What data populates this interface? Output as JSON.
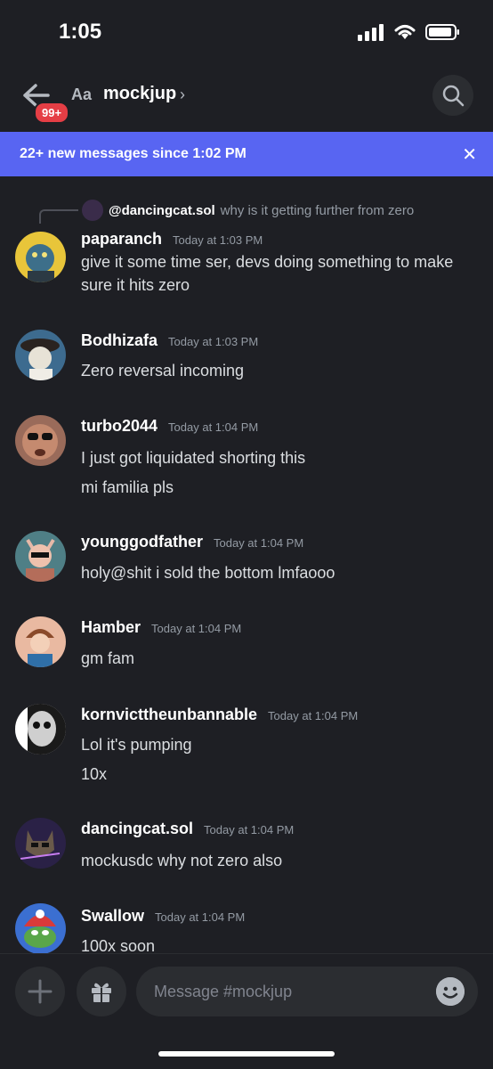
{
  "status": {
    "time": "1:05"
  },
  "header": {
    "badge": "99+",
    "aa": "Aa",
    "channel": "mockjup",
    "chevron": "›"
  },
  "banner": {
    "text": "22+ new messages since 1:02 PM",
    "close": "✕"
  },
  "reply": {
    "author": "@dancingcat.sol",
    "text": "why is it getting further from zero"
  },
  "messages": [
    {
      "author": "paparanch",
      "time": "Today at 1:03 PM",
      "lines": [
        "give it some time ser, devs doing something to make",
        "sure it hits zero"
      ],
      "avatar_color": "#e8c53a"
    },
    {
      "author": "Bodhizafa",
      "time": "Today at 1:03 PM",
      "lines": [
        "Zero reversal incoming"
      ],
      "avatar_color": "#3d6b8f"
    },
    {
      "author": "turbo2044",
      "time": "Today at 1:04 PM",
      "lines": [
        "I just got liquidated shorting this",
        "mi familia pls"
      ],
      "avatar_color": "#9a6b5a"
    },
    {
      "author": "younggodfather",
      "time": "Today at 1:04 PM",
      "lines": [
        "holy@shit i sold the bottom lmfaooo"
      ],
      "avatar_color": "#4f7f86"
    },
    {
      "author": "Hamber",
      "time": "Today at 1:04 PM",
      "lines": [
        "gm fam"
      ],
      "avatar_color": "#e9b9a1"
    },
    {
      "author": "kornvicttheunbannable",
      "time": "Today at 1:04 PM",
      "lines": [
        "Lol it's pumping",
        "10x"
      ],
      "avatar_color": "#d8d8d8"
    },
    {
      "author": "dancingcat.sol",
      "time": "Today at 1:04 PM",
      "lines": [
        "mockusdc why not zero also"
      ],
      "avatar_color": "#2a2146"
    },
    {
      "author": "Swallow",
      "time": "Today at 1:04 PM",
      "lines": [
        "100x soon"
      ],
      "avatar_color": "#3b6fd1"
    }
  ],
  "composer": {
    "placeholder": "Message #mockjup"
  },
  "icons": {
    "back": "back-arrow-icon",
    "search": "search-icon",
    "close": "close-icon",
    "plus": "plus-icon",
    "gift": "gift-icon",
    "emoji": "emoji-icon"
  },
  "colors": {
    "background": "#1e1f24",
    "banner": "#5865f2",
    "badge": "#e53e45",
    "input": "#2b2d31"
  }
}
